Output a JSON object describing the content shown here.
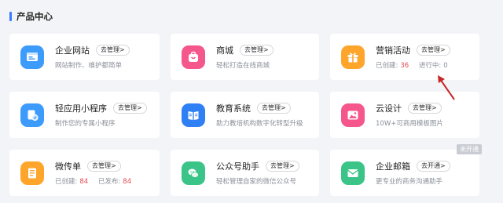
{
  "section": {
    "title": "产品中心"
  },
  "accent_color": "#3a7afe",
  "cards": [
    {
      "name": "企业网站",
      "button": "去管理>",
      "desc": "网站制作、维护都简单",
      "icon": "website-icon",
      "color": "#3d9bfb"
    },
    {
      "name": "商城",
      "button": "去管理>",
      "desc": "轻松打造在线商城",
      "icon": "shop-bag-icon",
      "color": "#f5568c"
    },
    {
      "name": "营销活动",
      "button": "去管理>",
      "icon": "gift-icon",
      "color": "#ffa52b",
      "stats": {
        "created_label": "已创建:",
        "created": "36",
        "ongoing_label": "进行中:",
        "ongoing": "0"
      }
    },
    {
      "name": "轻应用小程序",
      "button": "去管理>",
      "desc": "制作您的专属小程序",
      "icon": "miniapp-icon",
      "color": "#3d9bfb"
    },
    {
      "name": "教育系统",
      "button": "去管理>",
      "desc": "助力教培机构数字化转型升级",
      "icon": "book-icon",
      "color": "#2f7ff5"
    },
    {
      "name": "云设计",
      "button": "去管理>",
      "desc": "10W+可商用模板图片",
      "icon": "image-icon",
      "color": "#f5568c"
    },
    {
      "name": "微传单",
      "button": "去管理>",
      "icon": "flyer-icon",
      "color": "#ffa52b",
      "stats": {
        "created_label": "已创建:",
        "created": "84",
        "ongoing_label": "已发布:",
        "ongoing": "84"
      }
    },
    {
      "name": "公众号助手",
      "button": "去管理>",
      "desc": "轻松管理自家的微信公众号",
      "icon": "wechat-icon",
      "color": "#3bc488"
    },
    {
      "name": "企业邮箱",
      "button": "去开通>",
      "desc": "更专业的商务沟通助手",
      "icon": "mail-icon",
      "color": "#3bc488",
      "badge": "未开通"
    }
  ]
}
